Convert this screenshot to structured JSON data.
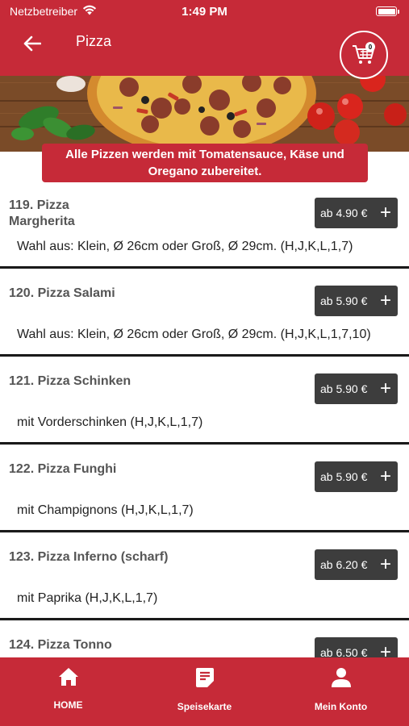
{
  "status_bar": {
    "carrier": "Netzbetreiber",
    "time": "1:49 PM",
    "wifi_icon": "wifi-icon",
    "battery_icon": "battery-icon"
  },
  "nav": {
    "title": "Pizza",
    "back_icon": "arrow-left-icon",
    "cart_icon": "shopping-cart-icon",
    "cart_count": "0"
  },
  "banner": {
    "notice": "Alle Pizzen werden mit Tomatensauce, Käse und Oregano zubereitet."
  },
  "items": [
    {
      "title": "119. Pizza Margherita",
      "price": "ab 4.90 €",
      "desc": "Wahl aus: Klein, Ø 26cm oder Groß, Ø 29cm. (H,J,K,L,1,7)"
    },
    {
      "title": "120. Pizza Salami",
      "price": "ab 5.90 €",
      "desc": "Wahl aus: Klein, Ø 26cm oder Groß, Ø 29cm. (H,J,K,L,1,7,10)"
    },
    {
      "title": "121. Pizza Schinken",
      "price": "ab 5.90 €",
      "desc": "mit Vorderschinken (H,J,K,L,1,7)"
    },
    {
      "title": "122. Pizza Funghi",
      "price": "ab 5.90 €",
      "desc": "mit Champignons (H,J,K,L,1,7)"
    },
    {
      "title": "123. Pizza Inferno (scharf)",
      "price": "ab 6.20 €",
      "desc": "mit Paprika (H,J,K,L,1,7)"
    },
    {
      "title": "124. Pizza Tonno",
      "price": "ab 6.50 €",
      "desc": ""
    }
  ],
  "bottom_nav": [
    {
      "label": "HOME",
      "icon": "home-icon"
    },
    {
      "label": "Speisekarte",
      "icon": "menu-card-icon"
    },
    {
      "label": "Mein Konto",
      "icon": "user-icon"
    }
  ],
  "colors": {
    "brand_red": "#c62a38",
    "price_button": "#3d3d3d"
  }
}
